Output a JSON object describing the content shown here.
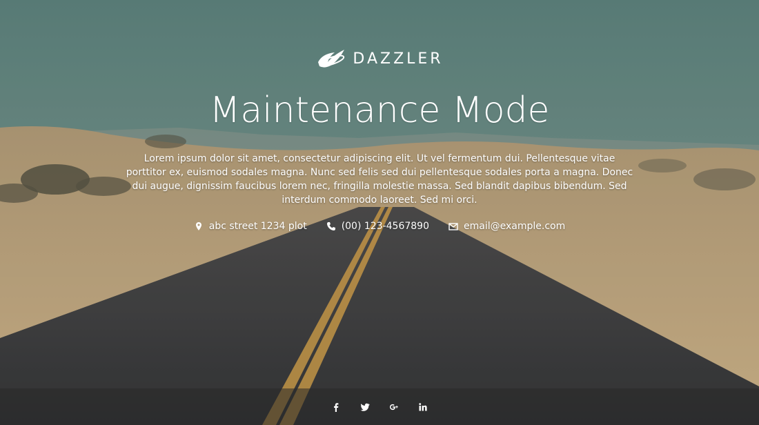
{
  "brand": {
    "name": "DAZZLER",
    "logo_icon": "dazzler-logo-icon"
  },
  "hero": {
    "title": "Maintenance Mode",
    "description": "Lorem ipsum dolor sit amet, consectetur adipiscing elit. Ut vel fermentum dui. Pellentesque vitae porttitor ex, euismod sodales magna. Nunc sed felis sed dui pellentesque sodales porta a magna. Donec dui augue, dignissim faucibus lorem nec, fringilla molestie massa. Sed blandit dapibus bibendum. Sed interdum commodo laoreet. Sed mi orci."
  },
  "contacts": [
    {
      "icon": "map-marker-icon",
      "text": "abc street 1234 plot"
    },
    {
      "icon": "phone-icon",
      "text": "(00) 123-4567890"
    },
    {
      "icon": "envelope-icon",
      "text": "email@example.com"
    }
  ],
  "footer": {
    "social": [
      {
        "icon": "facebook-icon"
      },
      {
        "icon": "twitter-icon"
      },
      {
        "icon": "google-plus-icon"
      },
      {
        "icon": "linkedin-icon"
      }
    ]
  },
  "colors": {
    "sky": "#6e8c86",
    "sand": "#c9ad82",
    "road": "#3f3f42",
    "road_line": "#d8a34a",
    "footer_bg": "#2a2a2a"
  }
}
